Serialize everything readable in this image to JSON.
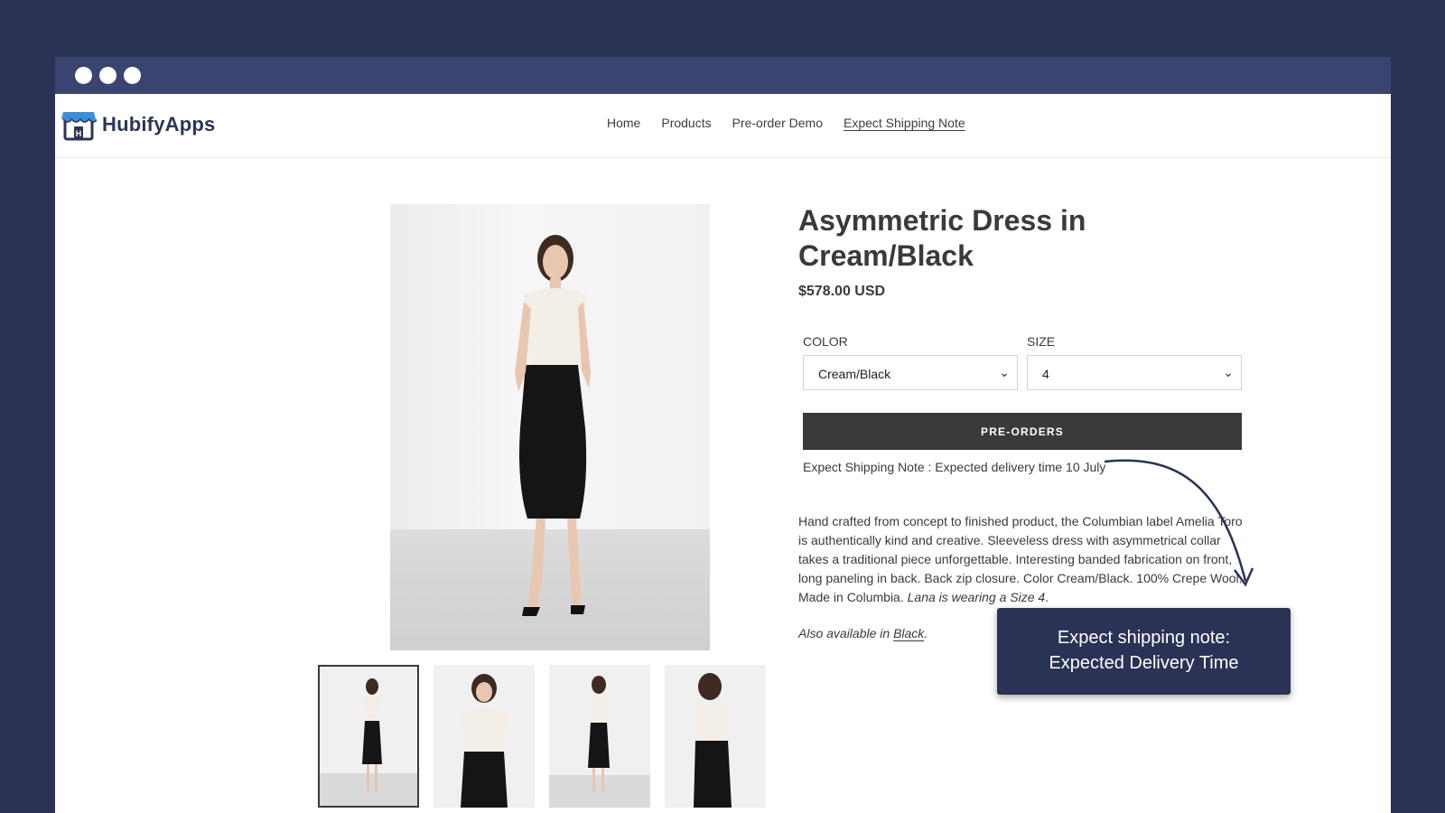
{
  "brand": {
    "name": "HubifyApps",
    "accent": "#2a3256"
  },
  "nav": {
    "items": [
      "Home",
      "Products",
      "Pre-order Demo",
      "Expect Shipping Note"
    ],
    "active_index": 3
  },
  "product": {
    "title": "Asymmetric Dress in Cream/Black",
    "price": "$578.00 USD",
    "color_label": "COLOR",
    "color_value": "Cream/Black",
    "size_label": "SIZE",
    "size_value": "4",
    "button_label": "PRE-ORDERS",
    "shipping_note": "Expect Shipping Note : Expected delivery time 10 July",
    "description": "Hand crafted from concept to finished product, the Columbian label Amelia Toro is authentically kind and creative. Sleeveless dress with asymmetrical collar takes a traditional piece unforgettable. Interesting banded fabrication on front, long paneling in back. Back zip closure. Color Cream/Black. 100% Crepe Wool. Made in Columbia.",
    "description_italic": "Lana is wearing a Size 4",
    "also_prefix": "Also available in",
    "also_link": "Black"
  },
  "callout": {
    "line1": "Expect shipping note:",
    "line2": "Expected Delivery Time"
  },
  "icons": {
    "store": "store-icon",
    "chevron": "chevron-down-icon"
  }
}
